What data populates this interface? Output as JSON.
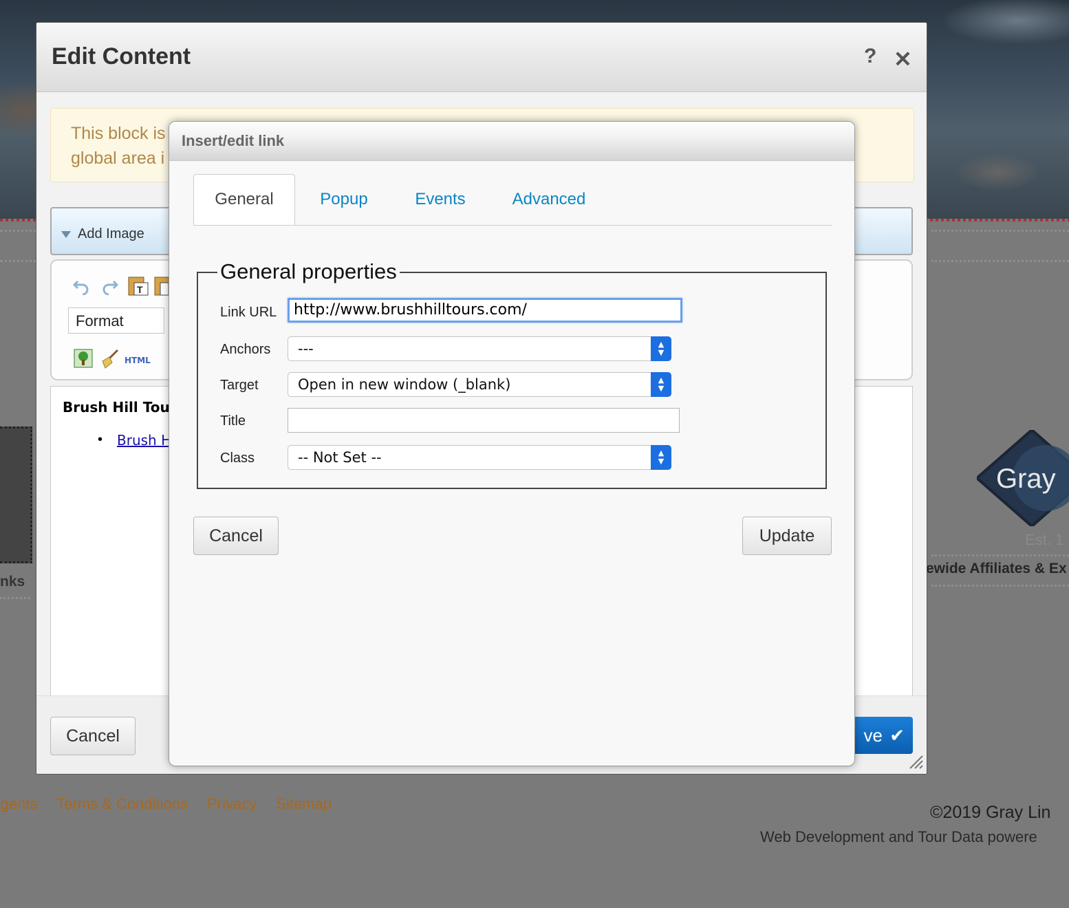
{
  "background": {
    "footer_links": [
      "Agents",
      "Terms & Conditions",
      "Privacy",
      "Sitemap"
    ],
    "copyright": "©2019 Gray Lin",
    "powered_by": "Web Development and Tour Data powere",
    "affiliates": "ewide Affiliates & Ex",
    "left_nav_text": "nks",
    "logo_text": "Gray",
    "logo_tagline": "Est. 1"
  },
  "edit_content": {
    "title": "Edit Content",
    "help_label": "?",
    "close_label": "✕",
    "warning_text": "This block is global area i",
    "warning_line1": "This block is",
    "warning_line2": "global area i",
    "add_image_label": "Add Image",
    "format_label": "Format",
    "html_button_label": "HTML",
    "editor_heading": "Brush Hill Tou",
    "editor_link_text": "Brush H",
    "cancel_label": "Cancel",
    "save_label": "ve",
    "icons": {
      "undo": "undo-icon",
      "redo": "redo-icon",
      "paste_text": "paste-text-icon",
      "paste_word": "paste-word-icon",
      "image": "image-icon",
      "cleanup": "broom-icon",
      "check": "checkmark-icon",
      "resize": "resize-grip-icon"
    }
  },
  "link_dialog": {
    "title": "Insert/edit link",
    "tabs": [
      {
        "label": "General",
        "active": true
      },
      {
        "label": "Popup",
        "active": false
      },
      {
        "label": "Events",
        "active": false
      },
      {
        "label": "Advanced",
        "active": false
      }
    ],
    "section_title": "General properties",
    "fields": {
      "link_url": {
        "label": "Link URL",
        "value": "http://www.brushhilltours.com/"
      },
      "anchors": {
        "label": "Anchors",
        "value": "---"
      },
      "target": {
        "label": "Target",
        "value": "Open in new window (_blank)"
      },
      "title": {
        "label": "Title",
        "value": ""
      },
      "class": {
        "label": "Class",
        "value": "-- Not Set --"
      }
    },
    "cancel_label": "Cancel",
    "update_label": "Update"
  },
  "colors": {
    "tab_link": "#0a86c7",
    "focus_ring": "#6aa0e8",
    "select_arrow": "#1b6fe0",
    "save_button": "#1d7ed8",
    "footer_link": "#a8681e",
    "warning_bg": "#fcf8e3"
  }
}
